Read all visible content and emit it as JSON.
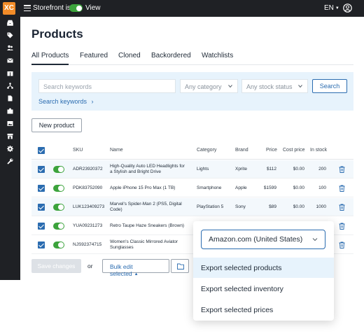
{
  "topbar": {
    "logo_text": "XC",
    "storefront_label": "Storefront is",
    "view_label": "View",
    "language": "EN"
  },
  "sidebar": {
    "icons": [
      "inbox-icon",
      "tag-icon",
      "users-icon",
      "mail-icon",
      "gift-icon",
      "sitemap-icon",
      "document-icon",
      "puzzle-icon",
      "image-icon",
      "store-icon",
      "settings-icon",
      "wrench-icon"
    ]
  },
  "page": {
    "title": "Products"
  },
  "tabs": [
    {
      "label": "All Products",
      "active": true
    },
    {
      "label": "Featured",
      "active": false
    },
    {
      "label": "Cloned",
      "active": false
    },
    {
      "label": "Backordered",
      "active": false
    },
    {
      "label": "Watchlists",
      "active": false
    }
  ],
  "filters": {
    "search_placeholder": "Search keywords",
    "category_placeholder": "Any category",
    "stock_placeholder": "Any stock status",
    "search_button": "Search",
    "search_keywords_link": "Search keywords"
  },
  "new_product_label": "New product",
  "table": {
    "headers": {
      "sku": "SKU",
      "name": "Name",
      "category": "Category",
      "brand": "Brand",
      "price": "Price",
      "cost": "Cost price",
      "stock": "In stock"
    },
    "rows": [
      {
        "sku": "ADR23920372",
        "name": "High-Quality Auto LED Headlights for a Stylish and Bright Drive",
        "category": "Lights",
        "brand": "Xprite",
        "price": "$112",
        "cost": "$0.00",
        "stock": "200"
      },
      {
        "sku": "PDK83752090",
        "name": "Apple iPhone 15 Pro Max (1 TB)",
        "category": "Smartphone",
        "brand": "Apple",
        "price": "$1599",
        "cost": "$0.00",
        "stock": "100"
      },
      {
        "sku": "LUK123409273",
        "name": "Marvel's Spider-Man 2 (PS5, Digital Code)",
        "category": "PlayStation 5",
        "brand": "Sony",
        "price": "$89",
        "cost": "$0.00",
        "stock": "1000"
      },
      {
        "sku": "YUA09231273",
        "name": "Retro Taupe Haze Sneakers (Brown)",
        "category": "",
        "brand": "",
        "price": "",
        "cost": "",
        "stock": ""
      },
      {
        "sku": "NJS92374715",
        "name": "Women's Classic Mirrored Aviator Sunglasses",
        "category": "",
        "brand": "",
        "price": "",
        "cost": "",
        "stock": ""
      }
    ]
  },
  "footer": {
    "save_label": "Save changes",
    "or_label": "or",
    "bulk_edit_label": "Bulk edit selected"
  },
  "export_popup": {
    "marketplace": "Amazon.com (United States)",
    "items": [
      "Export selected products",
      "Export selected inventory",
      "Export selected prices"
    ],
    "highlighted_index": 0
  },
  "colors": {
    "accent": "#2b6cb0",
    "toggle_on": "#3ca33c",
    "logo": "#f28c28",
    "dark_bar": "#1f2125",
    "panel": "#e7f3fc"
  }
}
